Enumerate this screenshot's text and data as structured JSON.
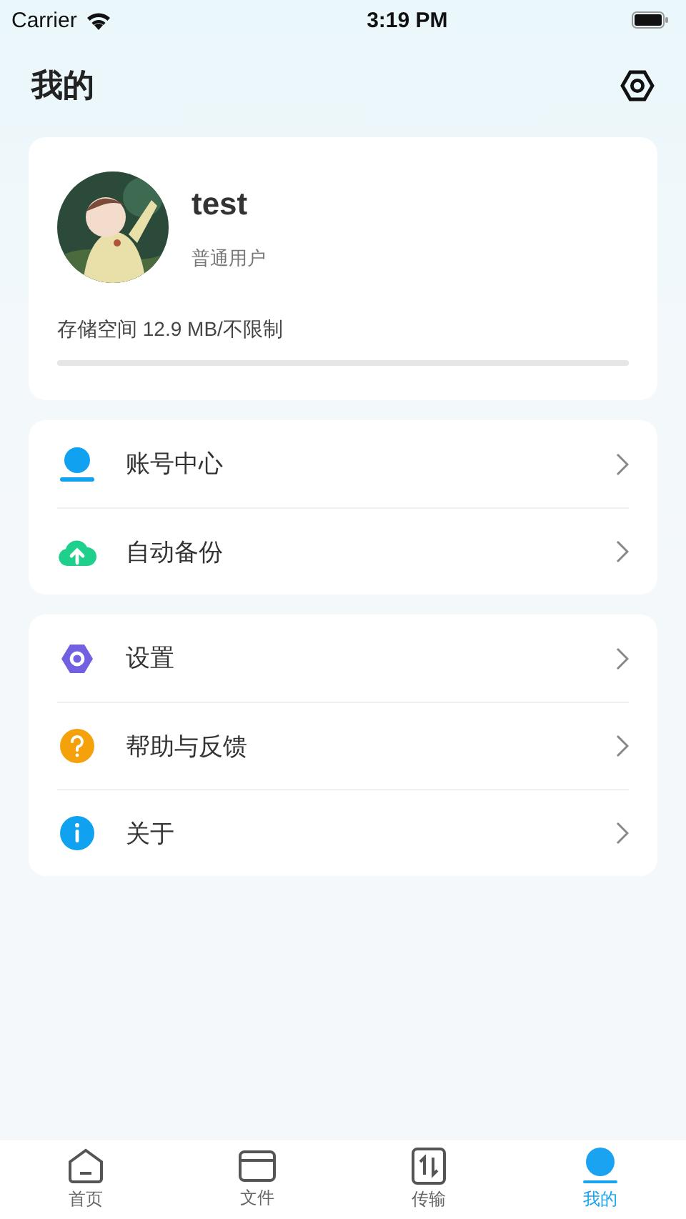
{
  "status_bar": {
    "carrier": "Carrier",
    "time": "3:19 PM"
  },
  "header": {
    "title": "我的"
  },
  "profile": {
    "name": "test",
    "role": "普通用户",
    "storage": "存储空间 12.9 MB/不限制"
  },
  "menu_groups": [
    {
      "items": [
        {
          "kind": "account",
          "label": "账号中心"
        },
        {
          "kind": "backup",
          "label": "自动备份"
        }
      ]
    },
    {
      "items": [
        {
          "kind": "settings",
          "label": "设置"
        },
        {
          "kind": "help",
          "label": "帮助与反馈"
        },
        {
          "kind": "about",
          "label": "关于"
        }
      ]
    }
  ],
  "tabs": [
    {
      "kind": "home",
      "label": "首页",
      "selected": false
    },
    {
      "kind": "files",
      "label": "文件",
      "selected": false
    },
    {
      "kind": "transfer",
      "label": "传输",
      "selected": false
    },
    {
      "kind": "me",
      "label": "我的",
      "selected": true
    }
  ]
}
